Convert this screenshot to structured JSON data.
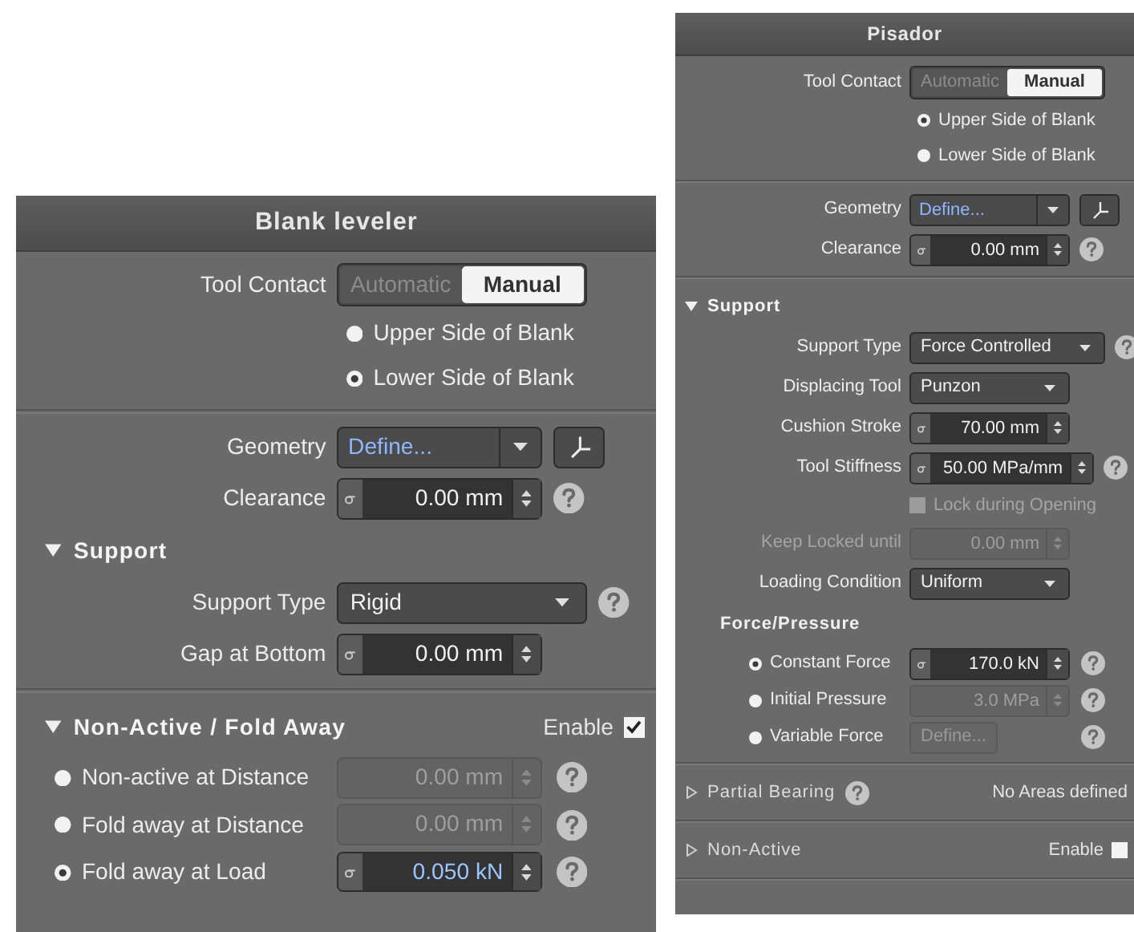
{
  "panels": [
    {
      "title": "Blank leveler",
      "items": [
        {
          "kind": "segmented",
          "label": "Tool Contact",
          "options": [
            {
              "label": "Automatic",
              "selected": false
            },
            {
              "label": "Manual",
              "selected": true
            }
          ]
        },
        {
          "kind": "radio",
          "label": "Upper Side of Blank",
          "selected": false
        },
        {
          "kind": "radio",
          "label": "Lower Side of Blank",
          "selected": true
        },
        {
          "kind": "divider"
        },
        {
          "kind": "geometry",
          "label": "Geometry",
          "value": "Define..."
        },
        {
          "kind": "spinner",
          "label": "Clearance",
          "value": "0.00 mm",
          "disabled": false,
          "help": true
        },
        {
          "kind": "section",
          "label": "Support",
          "expanded": true
        },
        {
          "kind": "dropdown",
          "label": "Support Type",
          "value": "Rigid",
          "help": true
        },
        {
          "kind": "spinner",
          "label": "Gap at Bottom",
          "value": "0.00 mm",
          "disabled": false
        },
        {
          "kind": "divider"
        },
        {
          "kind": "section",
          "label": "Non-Active / Fold Away",
          "expanded": true,
          "enable": {
            "label": "Enable",
            "checked": true
          }
        },
        {
          "kind": "radio_field",
          "label": "Non-active at Distance",
          "selected": false,
          "help": true,
          "field": {
            "kind": "spinner",
            "value": "0.00 mm",
            "disabled": true,
            "highlighted": false
          }
        },
        {
          "kind": "radio_field",
          "label": "Fold away at Distance",
          "selected": false,
          "help": true,
          "field": {
            "kind": "spinner",
            "value": "0.00 mm",
            "disabled": true,
            "highlighted": false
          }
        },
        {
          "kind": "radio_field",
          "label": "Fold away at Load",
          "selected": true,
          "help": true,
          "field": {
            "kind": "spinner",
            "value": "0.050 kN",
            "disabled": false,
            "highlighted": true
          }
        }
      ]
    },
    {
      "title": "Pisador",
      "items": [
        {
          "kind": "segmented",
          "label": "Tool Contact",
          "options": [
            {
              "label": "Automatic",
              "selected": false
            },
            {
              "label": "Manual",
              "selected": true
            }
          ]
        },
        {
          "kind": "radio",
          "label": "Upper Side of Blank",
          "selected": true
        },
        {
          "kind": "radio",
          "label": "Lower Side of Blank",
          "selected": false
        },
        {
          "kind": "divider"
        },
        {
          "kind": "geometry",
          "label": "Geometry",
          "value": "Define..."
        },
        {
          "kind": "spinner",
          "label": "Clearance",
          "value": "0.00 mm",
          "disabled": false,
          "help": true
        },
        {
          "kind": "divider"
        },
        {
          "kind": "section",
          "label": "Support",
          "expanded": true
        },
        {
          "kind": "dropdown",
          "label": "Support Type",
          "value": "Force Controlled",
          "help": true
        },
        {
          "kind": "dropdown",
          "label": "Displacing Tool",
          "value": "Punzon"
        },
        {
          "kind": "spinner",
          "label": "Cushion Stroke",
          "value": "70.00 mm",
          "disabled": false
        },
        {
          "kind": "spinner",
          "label": "Tool Stiffness",
          "value": "50.00 MPa/mm",
          "disabled": false,
          "help": true
        },
        {
          "kind": "checkbox",
          "label": "Lock during Opening",
          "checked": false,
          "disabled": true
        },
        {
          "kind": "spinner",
          "label": "Keep Locked until",
          "value": "0.00 mm",
          "disabled": true
        },
        {
          "kind": "dropdown",
          "label": "Loading Condition",
          "value": "Uniform"
        },
        {
          "kind": "heading",
          "label": "Force/Pressure"
        },
        {
          "kind": "radio_field",
          "label": "Constant Force",
          "selected": true,
          "help": true,
          "field": {
            "kind": "spinner",
            "value": "170.0 kN",
            "disabled": false,
            "highlighted": false
          }
        },
        {
          "kind": "radio_field",
          "label": "Initial Pressure",
          "selected": false,
          "help": true,
          "field": {
            "kind": "spinner",
            "value": "3.0 MPa",
            "disabled": true,
            "highlighted": false
          }
        },
        {
          "kind": "radio_field",
          "label": "Variable Force",
          "selected": false,
          "help": true,
          "field": {
            "kind": "button",
            "value": "Define...",
            "disabled": true
          }
        },
        {
          "kind": "divider"
        },
        {
          "kind": "section",
          "label": "Partial Bearing",
          "expanded": false,
          "help": true,
          "note": "No Areas defined"
        },
        {
          "kind": "divider"
        },
        {
          "kind": "section",
          "label": "Non-Active",
          "expanded": false,
          "enable": {
            "label": "Enable",
            "checked": false
          }
        },
        {
          "kind": "divider"
        }
      ]
    }
  ]
}
